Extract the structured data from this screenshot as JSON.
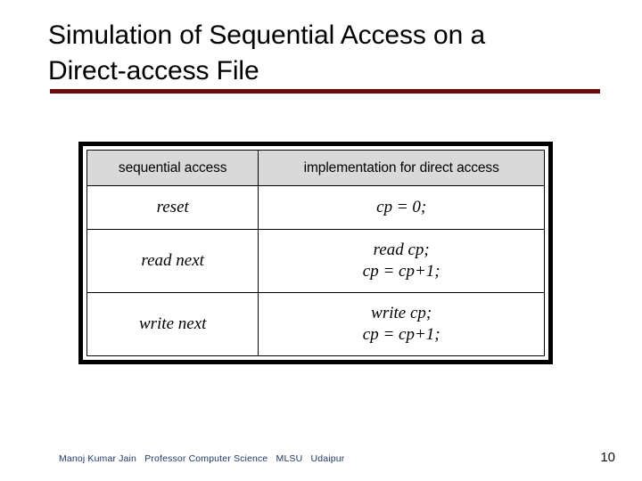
{
  "slide": {
    "title": "Simulation of Sequential Access on a\nDirect-access File",
    "rule_color": "#6B0A0A",
    "page_number": "10",
    "footer": "Manoj Kumar Jain   Professor Computer Science   MLSU   Udaipur",
    "footer_color": "#1F3864"
  },
  "table": {
    "header_background": "#d9d9d9",
    "border_color": "#000000",
    "headers": [
      "sequential access",
      "implementation for direct access"
    ],
    "rows": [
      {
        "sequential_access": "reset",
        "implementation": "cp = 0;"
      },
      {
        "sequential_access": "read next",
        "implementation": "read cp;\ncp = cp+1;"
      },
      {
        "sequential_access": "write next",
        "implementation": "write cp;\ncp = cp+1;"
      }
    ]
  }
}
